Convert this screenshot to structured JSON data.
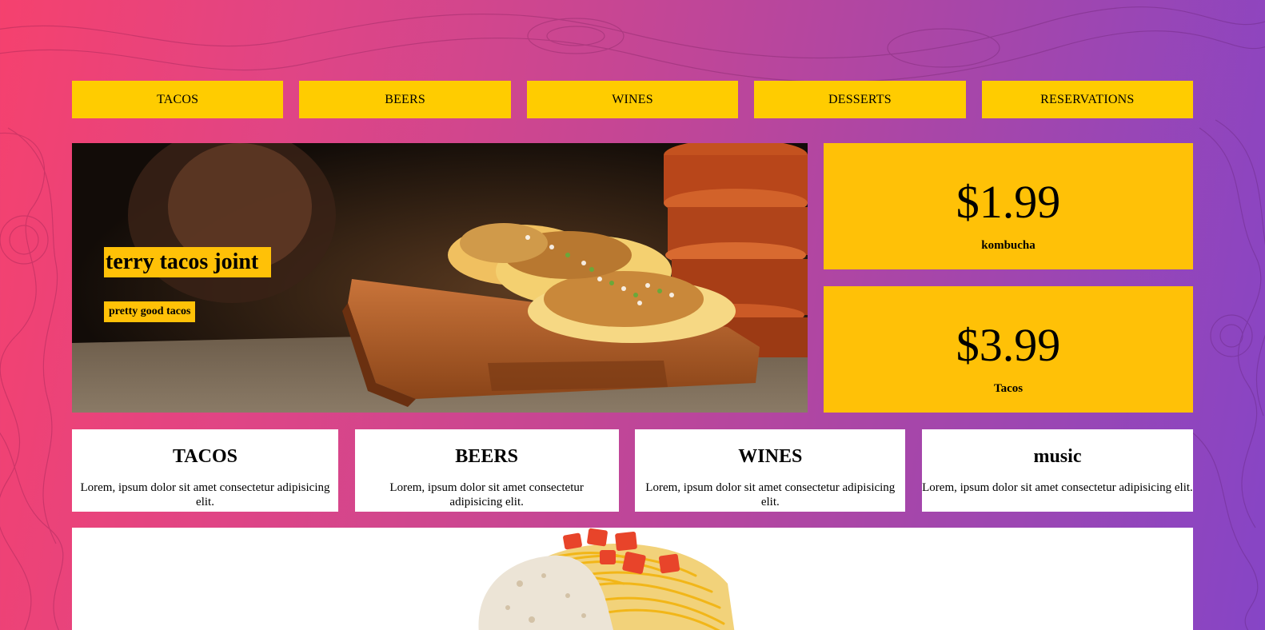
{
  "nav": {
    "items": [
      {
        "label": "TACOS"
      },
      {
        "label": "BEERS"
      },
      {
        "label": "WINES"
      },
      {
        "label": "DESSERTS"
      },
      {
        "label": "RESERVATIONS"
      }
    ]
  },
  "hero": {
    "title": "terry tacos joint",
    "subtitle": "pretty good tacos"
  },
  "prices": [
    {
      "value": "$1.99",
      "label": "kombucha"
    },
    {
      "value": "$3.99",
      "label": "Tacos"
    }
  ],
  "cards": [
    {
      "title": "TACOS",
      "text": "Lorem, ipsum dolor sit amet consectetur adipisicing elit."
    },
    {
      "title": "BEERS",
      "text": "Lorem, ipsum dolor sit amet consectetur adipisicing elit."
    },
    {
      "title": "WINES",
      "text": "Lorem, ipsum dolor sit amet consectetur adipisicing elit."
    },
    {
      "title": "music",
      "text": "Lorem, ipsum dolor sit amet consectetur adipisicing elit."
    }
  ],
  "colors": {
    "accent": "#ffcc00",
    "price_bg": "#ffc107",
    "gradient_start": "#f5416e",
    "gradient_end": "#8645c6"
  }
}
